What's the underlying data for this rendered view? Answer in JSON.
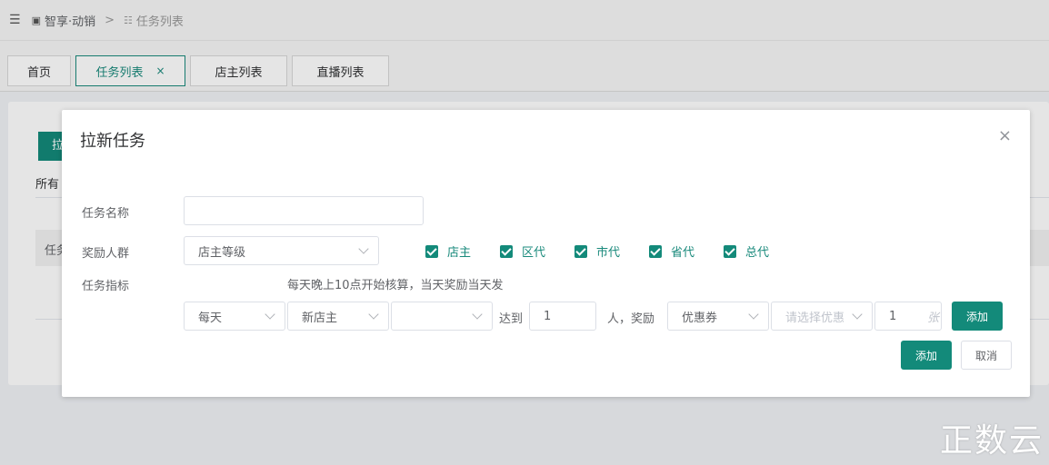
{
  "breadcrumb": {
    "root": "智享·动销",
    "separator": ">",
    "current": "任务列表"
  },
  "tabs": [
    {
      "label": "首页"
    },
    {
      "label": "任务列表",
      "close": "×"
    },
    {
      "label": "店主列表"
    },
    {
      "label": "直播列表"
    }
  ],
  "page": {
    "button_label_partial": "拉",
    "all_label_partial": "所有",
    "table_header_partial": "任务"
  },
  "dialog": {
    "title": "拉新任务",
    "close": "×",
    "task_name_label": "任务名称",
    "task_name_value": "",
    "reward_group_label": "奖励人群",
    "reward_group_select": "店主等级",
    "reward_levels": [
      "店主",
      "区代",
      "市代",
      "省代",
      "总代"
    ],
    "task_indicator_label": "任务指标",
    "indicator_hint": "每天晚上10点开始核算，当天奖励当天发",
    "period_select": "每天",
    "type_select": "新店主",
    "third_select": "",
    "reach_label": "达到",
    "reach_value": "1",
    "people_reward_label": "人，奖励",
    "reward_type_select": "优惠券",
    "coupon_select_placeholder": "请选择优惠",
    "quantity_value": "1",
    "quantity_unit": "张",
    "add_row_button": "添加",
    "submit_button": "添加",
    "cancel_button": "取消"
  },
  "watermark": "正数云",
  "colors": {
    "primary": "#138a7a",
    "primary_text": "#1a8a7c"
  }
}
